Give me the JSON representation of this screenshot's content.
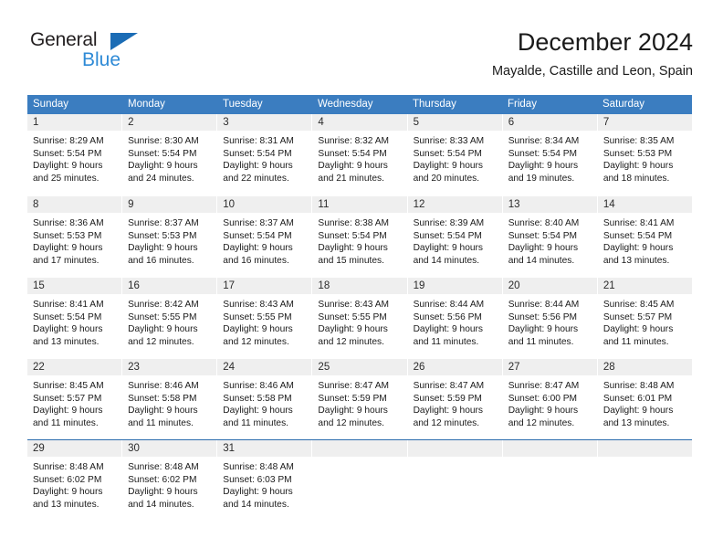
{
  "brand": {
    "name_part1": "General",
    "name_part2": "Blue"
  },
  "header": {
    "title": "December 2024",
    "subtitle": "Mayalde, Castille and Leon, Spain"
  },
  "calendar": {
    "weekdays": [
      "Sunday",
      "Monday",
      "Tuesday",
      "Wednesday",
      "Thursday",
      "Friday",
      "Saturday"
    ],
    "accent_color": "#3b7dc0",
    "day_band_color": "#efefef",
    "weeks": [
      [
        {
          "day": "1",
          "sunrise": "Sunrise: 8:29 AM",
          "sunset": "Sunset: 5:54 PM",
          "daylight1": "Daylight: 9 hours",
          "daylight2": "and 25 minutes."
        },
        {
          "day": "2",
          "sunrise": "Sunrise: 8:30 AM",
          "sunset": "Sunset: 5:54 PM",
          "daylight1": "Daylight: 9 hours",
          "daylight2": "and 24 minutes."
        },
        {
          "day": "3",
          "sunrise": "Sunrise: 8:31 AM",
          "sunset": "Sunset: 5:54 PM",
          "daylight1": "Daylight: 9 hours",
          "daylight2": "and 22 minutes."
        },
        {
          "day": "4",
          "sunrise": "Sunrise: 8:32 AM",
          "sunset": "Sunset: 5:54 PM",
          "daylight1": "Daylight: 9 hours",
          "daylight2": "and 21 minutes."
        },
        {
          "day": "5",
          "sunrise": "Sunrise: 8:33 AM",
          "sunset": "Sunset: 5:54 PM",
          "daylight1": "Daylight: 9 hours",
          "daylight2": "and 20 minutes."
        },
        {
          "day": "6",
          "sunrise": "Sunrise: 8:34 AM",
          "sunset": "Sunset: 5:54 PM",
          "daylight1": "Daylight: 9 hours",
          "daylight2": "and 19 minutes."
        },
        {
          "day": "7",
          "sunrise": "Sunrise: 8:35 AM",
          "sunset": "Sunset: 5:53 PM",
          "daylight1": "Daylight: 9 hours",
          "daylight2": "and 18 minutes."
        }
      ],
      [
        {
          "day": "8",
          "sunrise": "Sunrise: 8:36 AM",
          "sunset": "Sunset: 5:53 PM",
          "daylight1": "Daylight: 9 hours",
          "daylight2": "and 17 minutes."
        },
        {
          "day": "9",
          "sunrise": "Sunrise: 8:37 AM",
          "sunset": "Sunset: 5:53 PM",
          "daylight1": "Daylight: 9 hours",
          "daylight2": "and 16 minutes."
        },
        {
          "day": "10",
          "sunrise": "Sunrise: 8:37 AM",
          "sunset": "Sunset: 5:54 PM",
          "daylight1": "Daylight: 9 hours",
          "daylight2": "and 16 minutes."
        },
        {
          "day": "11",
          "sunrise": "Sunrise: 8:38 AM",
          "sunset": "Sunset: 5:54 PM",
          "daylight1": "Daylight: 9 hours",
          "daylight2": "and 15 minutes."
        },
        {
          "day": "12",
          "sunrise": "Sunrise: 8:39 AM",
          "sunset": "Sunset: 5:54 PM",
          "daylight1": "Daylight: 9 hours",
          "daylight2": "and 14 minutes."
        },
        {
          "day": "13",
          "sunrise": "Sunrise: 8:40 AM",
          "sunset": "Sunset: 5:54 PM",
          "daylight1": "Daylight: 9 hours",
          "daylight2": "and 14 minutes."
        },
        {
          "day": "14",
          "sunrise": "Sunrise: 8:41 AM",
          "sunset": "Sunset: 5:54 PM",
          "daylight1": "Daylight: 9 hours",
          "daylight2": "and 13 minutes."
        }
      ],
      [
        {
          "day": "15",
          "sunrise": "Sunrise: 8:41 AM",
          "sunset": "Sunset: 5:54 PM",
          "daylight1": "Daylight: 9 hours",
          "daylight2": "and 13 minutes."
        },
        {
          "day": "16",
          "sunrise": "Sunrise: 8:42 AM",
          "sunset": "Sunset: 5:55 PM",
          "daylight1": "Daylight: 9 hours",
          "daylight2": "and 12 minutes."
        },
        {
          "day": "17",
          "sunrise": "Sunrise: 8:43 AM",
          "sunset": "Sunset: 5:55 PM",
          "daylight1": "Daylight: 9 hours",
          "daylight2": "and 12 minutes."
        },
        {
          "day": "18",
          "sunrise": "Sunrise: 8:43 AM",
          "sunset": "Sunset: 5:55 PM",
          "daylight1": "Daylight: 9 hours",
          "daylight2": "and 12 minutes."
        },
        {
          "day": "19",
          "sunrise": "Sunrise: 8:44 AM",
          "sunset": "Sunset: 5:56 PM",
          "daylight1": "Daylight: 9 hours",
          "daylight2": "and 11 minutes."
        },
        {
          "day": "20",
          "sunrise": "Sunrise: 8:44 AM",
          "sunset": "Sunset: 5:56 PM",
          "daylight1": "Daylight: 9 hours",
          "daylight2": "and 11 minutes."
        },
        {
          "day": "21",
          "sunrise": "Sunrise: 8:45 AM",
          "sunset": "Sunset: 5:57 PM",
          "daylight1": "Daylight: 9 hours",
          "daylight2": "and 11 minutes."
        }
      ],
      [
        {
          "day": "22",
          "sunrise": "Sunrise: 8:45 AM",
          "sunset": "Sunset: 5:57 PM",
          "daylight1": "Daylight: 9 hours",
          "daylight2": "and 11 minutes."
        },
        {
          "day": "23",
          "sunrise": "Sunrise: 8:46 AM",
          "sunset": "Sunset: 5:58 PM",
          "daylight1": "Daylight: 9 hours",
          "daylight2": "and 11 minutes."
        },
        {
          "day": "24",
          "sunrise": "Sunrise: 8:46 AM",
          "sunset": "Sunset: 5:58 PM",
          "daylight1": "Daylight: 9 hours",
          "daylight2": "and 11 minutes."
        },
        {
          "day": "25",
          "sunrise": "Sunrise: 8:47 AM",
          "sunset": "Sunset: 5:59 PM",
          "daylight1": "Daylight: 9 hours",
          "daylight2": "and 12 minutes."
        },
        {
          "day": "26",
          "sunrise": "Sunrise: 8:47 AM",
          "sunset": "Sunset: 5:59 PM",
          "daylight1": "Daylight: 9 hours",
          "daylight2": "and 12 minutes."
        },
        {
          "day": "27",
          "sunrise": "Sunrise: 8:47 AM",
          "sunset": "Sunset: 6:00 PM",
          "daylight1": "Daylight: 9 hours",
          "daylight2": "and 12 minutes."
        },
        {
          "day": "28",
          "sunrise": "Sunrise: 8:48 AM",
          "sunset": "Sunset: 6:01 PM",
          "daylight1": "Daylight: 9 hours",
          "daylight2": "and 13 minutes."
        }
      ],
      [
        {
          "day": "29",
          "sunrise": "Sunrise: 8:48 AM",
          "sunset": "Sunset: 6:02 PM",
          "daylight1": "Daylight: 9 hours",
          "daylight2": "and 13 minutes."
        },
        {
          "day": "30",
          "sunrise": "Sunrise: 8:48 AM",
          "sunset": "Sunset: 6:02 PM",
          "daylight1": "Daylight: 9 hours",
          "daylight2": "and 14 minutes."
        },
        {
          "day": "31",
          "sunrise": "Sunrise: 8:48 AM",
          "sunset": "Sunset: 6:03 PM",
          "daylight1": "Daylight: 9 hours",
          "daylight2": "and 14 minutes."
        },
        {
          "day": "",
          "sunrise": "",
          "sunset": "",
          "daylight1": "",
          "daylight2": ""
        },
        {
          "day": "",
          "sunrise": "",
          "sunset": "",
          "daylight1": "",
          "daylight2": ""
        },
        {
          "day": "",
          "sunrise": "",
          "sunset": "",
          "daylight1": "",
          "daylight2": ""
        },
        {
          "day": "",
          "sunrise": "",
          "sunset": "",
          "daylight1": "",
          "daylight2": ""
        }
      ]
    ]
  }
}
